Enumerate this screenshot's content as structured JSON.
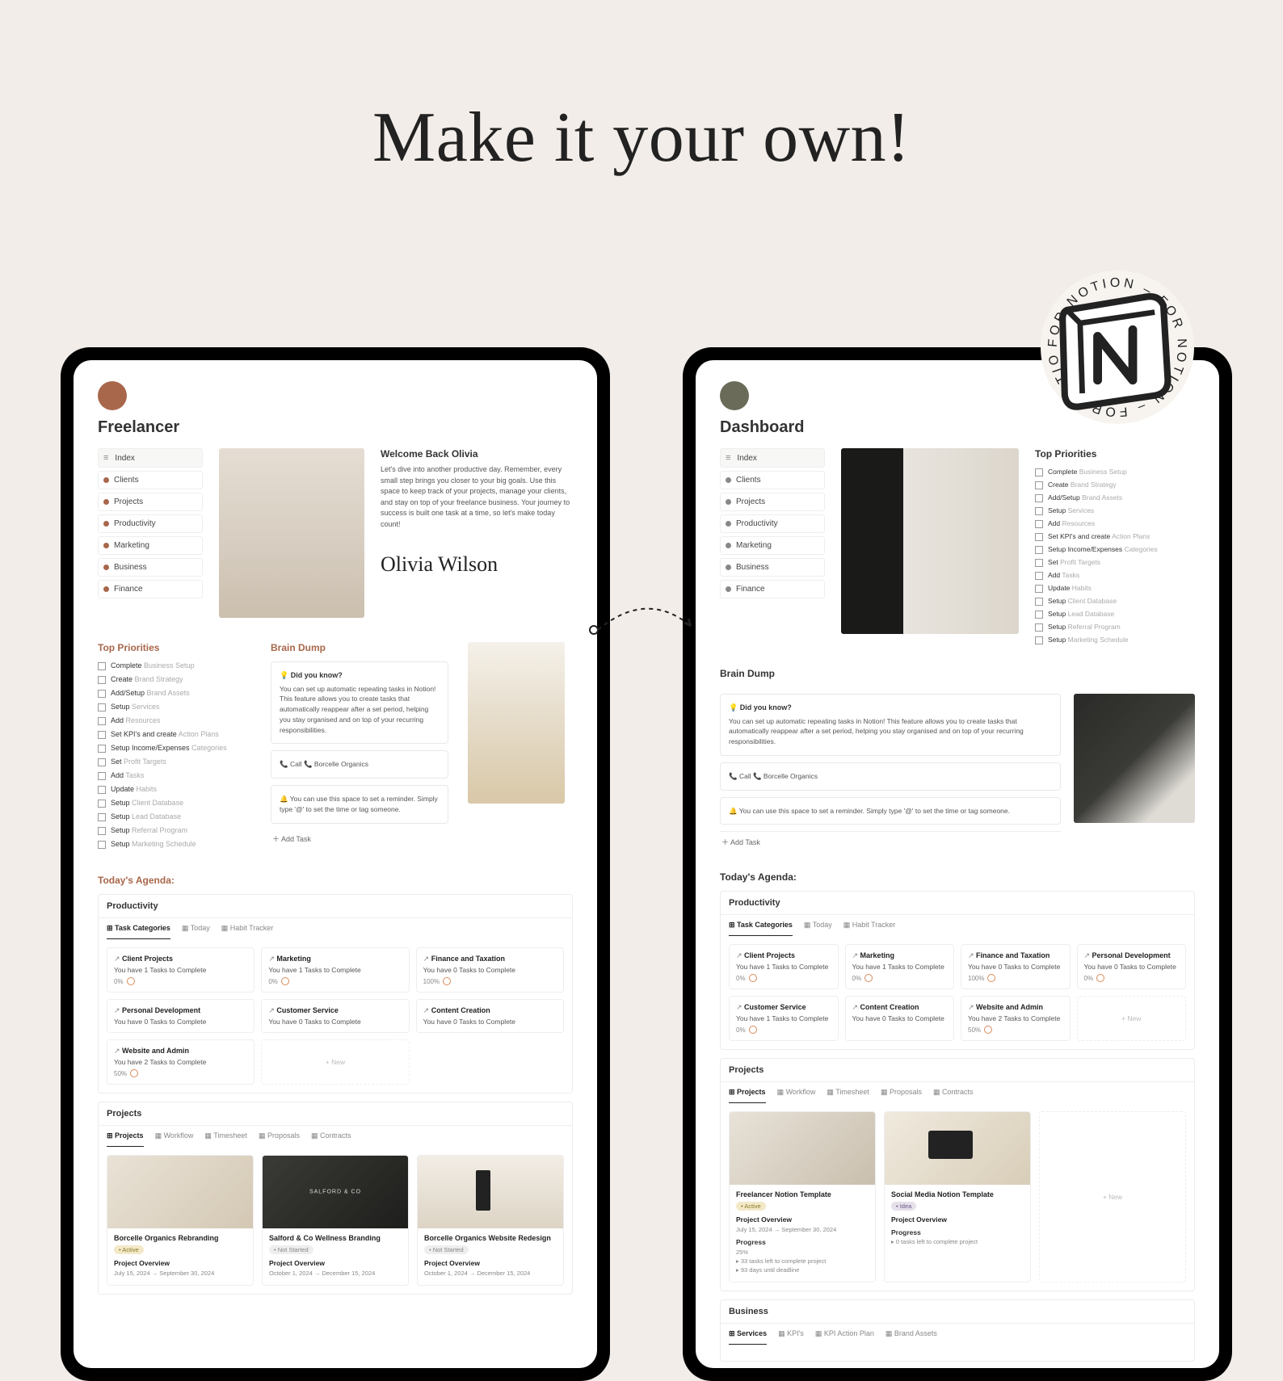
{
  "heading": "Make it your own!",
  "stamp": {
    "text": "FOR NOTION  –  FOR NOTION  –  FOR NOTION  –",
    "logo": "N"
  },
  "left": {
    "title": "Freelancer",
    "nav": [
      "Index",
      "Clients",
      "Projects",
      "Productivity",
      "Marketing",
      "Business",
      "Finance"
    ],
    "welcome": {
      "heading": "Welcome Back Olivia",
      "body": "Let's dive into another productive day. Remember, every small step brings you closer to your big goals. Use this space to keep track of your projects, manage your clients, and stay on top of your freelance business. Your journey to success is built one task at a time, so let's make today count!",
      "signature": "Olivia Wilson"
    },
    "priorities": {
      "title": "Top Priorities",
      "items": [
        {
          "a": "Complete",
          "b": "Business Setup"
        },
        {
          "a": "Create",
          "b": "Brand Strategy"
        },
        {
          "a": "Add/Setup",
          "b": "Brand Assets"
        },
        {
          "a": "Setup",
          "b": "Services"
        },
        {
          "a": "Add",
          "b": "Resources"
        },
        {
          "a": "Set KPI's and create",
          "b": "Action Plans"
        },
        {
          "a": "Setup Income/Expenses",
          "b": "Categories"
        },
        {
          "a": "Set",
          "b": "Profit Targets"
        },
        {
          "a": "Add",
          "b": "Tasks"
        },
        {
          "a": "Update",
          "b": "Habits"
        },
        {
          "a": "Setup",
          "b": "Client Database"
        },
        {
          "a": "Setup",
          "b": "Lead Database"
        },
        {
          "a": "Setup",
          "b": "Referral Program"
        },
        {
          "a": "Setup",
          "b": "Marketing Schedule"
        }
      ]
    },
    "braindump": {
      "title": "Brain Dump",
      "didyouknow_title": "Did you know?",
      "didyouknow": "You can set up automatic repeating tasks in Notion! This feature allows you to create tasks that automatically reappear after a set period, helping you stay organised and on top of your recurring responsibilities.",
      "call": "Call 📞 Borcelle Organics",
      "reminder": "You can use this space to set a reminder. Simply type '@' to set the time or tag someone.",
      "add": "Add Task"
    },
    "agenda": {
      "title": "Today's Agenda:",
      "productivity": "Productivity",
      "tabs": [
        "Task Categories",
        "Today",
        "Habit Tracker"
      ],
      "tiles": [
        {
          "name": "Client Projects",
          "sub": "You have 1 Tasks to Complete",
          "pct": "0%"
        },
        {
          "name": "Marketing",
          "sub": "You have 1 Tasks to Complete",
          "pct": "0%"
        },
        {
          "name": "Finance and Taxation",
          "sub": "You have 0 Tasks to Complete",
          "pct": "100%"
        },
        {
          "name": "Personal Development",
          "sub": "You have 0 Tasks to Complete",
          "pct": ""
        },
        {
          "name": "Customer Service",
          "sub": "You have 0 Tasks to Complete",
          "pct": ""
        },
        {
          "name": "Content Creation",
          "sub": "You have 0 Tasks to Complete",
          "pct": ""
        },
        {
          "name": "Website and Admin",
          "sub": "You have 2 Tasks to Complete",
          "pct": "50%"
        }
      ],
      "new": "+ New"
    },
    "projects": {
      "title": "Projects",
      "tabs": [
        "Projects",
        "Workflow",
        "Timesheet",
        "Proposals",
        "Contracts"
      ],
      "items": [
        {
          "name": "Borcelle Organics Rebranding",
          "status": "Active",
          "statusClass": "active",
          "ovw": "Project Overview",
          "dates": "July 15, 2024 → September 30, 2024",
          "thumb": "t1"
        },
        {
          "name": "Salford & Co Wellness Branding",
          "status": "Not Started",
          "statusClass": "notstarted",
          "ovw": "Project Overview",
          "dates": "October 1, 2024 → December 15, 2024",
          "thumb": "t2"
        },
        {
          "name": "Borcelle Organics Website Redesign",
          "status": "Not Started",
          "statusClass": "notstarted",
          "ovw": "Project Overview",
          "dates": "October 1, 2024 → December 15, 2024",
          "thumb": "t3"
        }
      ]
    }
  },
  "right": {
    "title": "Dashboard",
    "nav": [
      "Index",
      "Clients",
      "Projects",
      "Productivity",
      "Marketing",
      "Business",
      "Finance"
    ],
    "priorities": {
      "title": "Top Priorities",
      "items": [
        {
          "a": "Complete",
          "b": "Business Setup"
        },
        {
          "a": "Create",
          "b": "Brand Strategy"
        },
        {
          "a": "Add/Setup",
          "b": "Brand Assets"
        },
        {
          "a": "Setup",
          "b": "Services"
        },
        {
          "a": "Add",
          "b": "Resources"
        },
        {
          "a": "Set KPI's and create",
          "b": "Action Plans"
        },
        {
          "a": "Setup Income/Expenses",
          "b": "Categories"
        },
        {
          "a": "Set",
          "b": "Profit Targets"
        },
        {
          "a": "Add",
          "b": "Tasks"
        },
        {
          "a": "Update",
          "b": "Habits"
        },
        {
          "a": "Setup",
          "b": "Client Database"
        },
        {
          "a": "Setup",
          "b": "Lead Database"
        },
        {
          "a": "Setup",
          "b": "Referral Program"
        },
        {
          "a": "Setup",
          "b": "Marketing Schedule"
        }
      ]
    },
    "braindump": {
      "title": "Brain Dump",
      "didyouknow_title": "Did you know?",
      "didyouknow": "You can set up automatic repeating tasks in Notion! This feature allows you to create tasks that automatically reappear after a set period, helping you stay organised and on top of your recurring responsibilities.",
      "call": "Call 📞 Borcelle Organics",
      "reminder": "You can use this space to set a reminder. Simply type '@' to set the time or tag someone.",
      "add": "Add Task"
    },
    "agenda": {
      "title": "Today's Agenda:",
      "productivity": "Productivity",
      "tabs": [
        "Task Categories",
        "Today",
        "Habit Tracker"
      ],
      "tiles": [
        {
          "name": "Client Projects",
          "sub": "You have 1 Tasks to Complete",
          "pct": "0%"
        },
        {
          "name": "Marketing",
          "sub": "You have 1 Tasks to Complete",
          "pct": "0%"
        },
        {
          "name": "Finance and Taxation",
          "sub": "You have 0 Tasks to Complete",
          "pct": "100%"
        },
        {
          "name": "Personal Development",
          "sub": "You have 0 Tasks to Complete",
          "pct": "0%"
        },
        {
          "name": "Customer Service",
          "sub": "You have 1 Tasks to Complete",
          "pct": "0%"
        },
        {
          "name": "Content Creation",
          "sub": "You have 0 Tasks to Complete",
          "pct": ""
        },
        {
          "name": "Website and Admin",
          "sub": "You have 2 Tasks to Complete",
          "pct": "50%"
        }
      ],
      "new": "+ New"
    },
    "projects": {
      "title": "Projects",
      "tabs": [
        "Projects",
        "Workflow",
        "Timesheet",
        "Proposals",
        "Contracts"
      ],
      "items": [
        {
          "name": "Freelancer Notion Template",
          "status": "Active",
          "statusClass": "active",
          "ovw": "Project Overview",
          "dates": "July 15, 2024 → September 30, 2024",
          "prog": "Progress",
          "pval": "25%",
          "b1": "▸ 33 tasks left to complete project",
          "b2": "▸ 93 days until deadline",
          "thumb": "t4"
        },
        {
          "name": "Social Media Notion Template",
          "status": "Idea",
          "statusClass": "idea",
          "ovw": "Project Overview",
          "dates": "",
          "prog": "Progress",
          "pval": "",
          "b1": "▸ 0 tasks left to complete project",
          "b2": "",
          "thumb": "t5"
        }
      ],
      "new": "+ New"
    },
    "business": {
      "title": "Business",
      "tabs": [
        "Services",
        "KPI's",
        "KPI Action Plan",
        "Brand Assets"
      ]
    }
  }
}
